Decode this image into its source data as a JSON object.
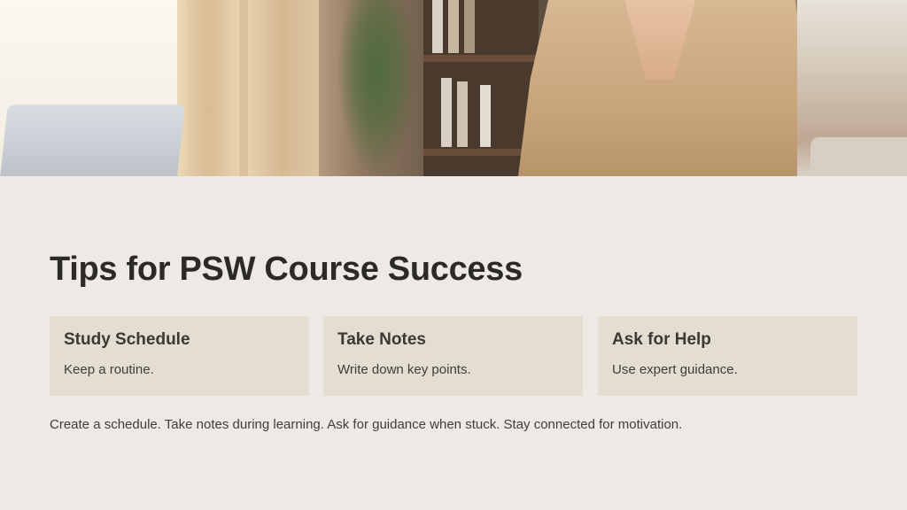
{
  "slide": {
    "title": "Tips for PSW Course Success",
    "cards": [
      {
        "title": "Study Schedule",
        "text": "Keep a routine."
      },
      {
        "title": "Take Notes",
        "text": "Write down key points."
      },
      {
        "title": "Ask for Help",
        "text": "Use expert guidance."
      }
    ],
    "summary": "Create a schedule. Take notes during learning. Ask for guidance when stuck. Stay connected for motivation."
  },
  "colors": {
    "background": "#edeae5",
    "card_background": "#e4ddd2",
    "title_text": "#2b2a26",
    "body_text": "#3e3d38"
  },
  "hero_image": {
    "icon": "photo-person-at-desk-icon"
  }
}
